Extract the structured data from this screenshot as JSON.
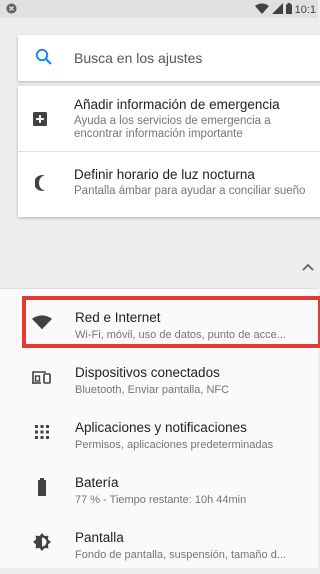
{
  "status": {
    "left_icon": "close-circle-icon",
    "time": "10:1",
    "icons": [
      "wifi-icon",
      "signal-icon",
      "battery-icon"
    ]
  },
  "search": {
    "placeholder": "Busca en los ajustes"
  },
  "suggestions": [
    {
      "title": "Añadir información de emergencia",
      "subtitle_lines": [
        "Ayuda a los servicios de emergencia a",
        "encontrar información importante"
      ],
      "icon": "plus-box-icon"
    },
    {
      "title": "Definir horario de luz nocturna",
      "subtitle_lines": [
        "Pantalla ámbar para ayudar a conciliar sueño"
      ],
      "icon": "moon-icon"
    }
  ],
  "collapse_icon": "chevron-up-icon",
  "settings": [
    {
      "title": "Red e Internet",
      "subtitle": "Wi-Fi, móvil, uso de datos, punto de acce...",
      "icon": "wifi-icon",
      "highlighted": true
    },
    {
      "title": "Dispositivos conectados",
      "subtitle": "Bluetooth, Enviar pantalla, NFC",
      "icon": "devices-icon"
    },
    {
      "title": "Aplicaciones y notificaciones",
      "subtitle": "Permisos, aplicaciones predeterminadas",
      "icon": "apps-grid-icon"
    },
    {
      "title": "Batería",
      "subtitle": "77 % - Tiempo restante: 10h 44min",
      "icon": "battery-icon"
    },
    {
      "title": "Pantalla",
      "subtitle": "Fondo de pantalla, suspensión, tamaño d...",
      "icon": "brightness-icon"
    }
  ],
  "colors": {
    "accent": "#1e88e5",
    "highlight": "#e53935"
  }
}
